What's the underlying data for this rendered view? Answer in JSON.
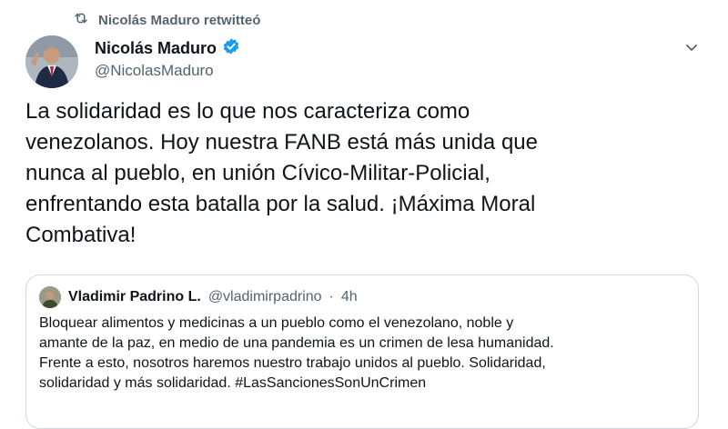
{
  "retweet": {
    "icon": "retweet-icon",
    "label": "Nicolás Maduro retwitteó"
  },
  "tweet": {
    "author_name": "Nicolás Maduro",
    "author_handle": "@NicolasMaduro",
    "verified": true,
    "text": "La solidaridad es lo que nos caracteriza como\nvenezolanos. Hoy nuestra FANB está más unida que\nnunca al pueblo, en unión Cívico-Militar-Policial,\nenfrentando esta batalla por la salud. ¡Máxima Moral\nCombativa!"
  },
  "quoted": {
    "author_name": "Vladimir Padrino L.",
    "author_handle": "@vladimirpadrino",
    "separator": "·",
    "time": "4h",
    "text": "Bloquear alimentos y medicinas a un pueblo como el venezolano, noble y\namante de la paz, en medio de una pandemia es un crimen de lesa humanidad.\nFrente a esto, nosotros haremos nuestro trabajo unidos al pueblo. Solidaridad,\nsolidaridad y más solidaridad. #LasSancionesSonUnCrimen"
  },
  "colors": {
    "verified": "#1d9bf0",
    "secondary_text": "#536471",
    "border": "#cfd9de"
  }
}
